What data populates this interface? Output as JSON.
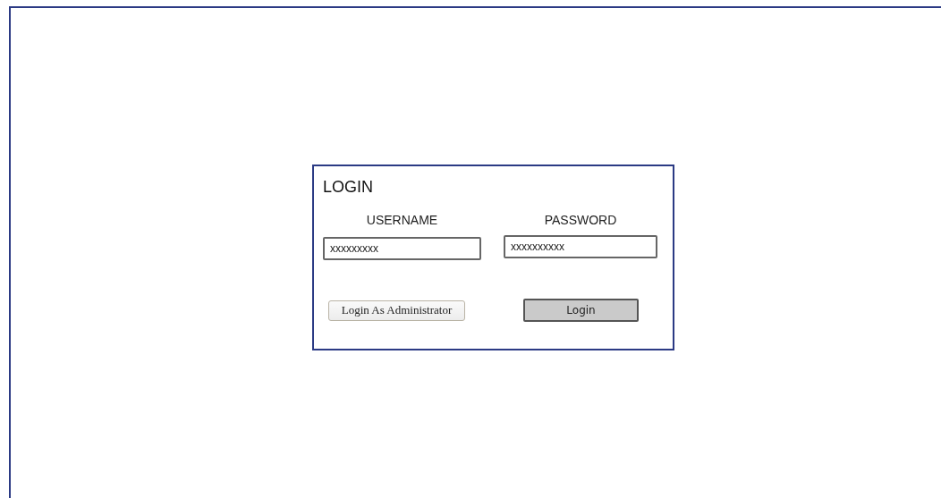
{
  "login": {
    "title": "LOGIN",
    "fields": [
      {
        "label": "USERNAME",
        "value": "xxxxxxxxx"
      },
      {
        "label": "PASSWORD",
        "value": "xxxxxxxxxx"
      }
    ],
    "buttons": [
      {
        "kind": "secondary",
        "label": "Login As Administrator"
      },
      {
        "kind": "primary",
        "label": "Login"
      }
    ]
  }
}
